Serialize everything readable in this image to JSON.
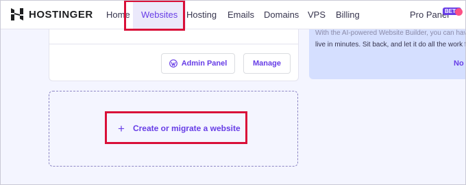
{
  "brand": {
    "name": "HOSTINGER"
  },
  "nav": {
    "items": [
      {
        "label": "Home"
      },
      {
        "label": "Websites"
      },
      {
        "label": "Hosting"
      },
      {
        "label": "Emails"
      },
      {
        "label": "Domains"
      },
      {
        "label": "VPS"
      },
      {
        "label": "Billing"
      },
      {
        "label": "Pro Panel"
      }
    ],
    "active": "Websites",
    "badge": "BETA"
  },
  "site_card": {
    "admin_panel_label": "Admin Panel",
    "manage_label": "Manage"
  },
  "promo": {
    "line1": "With the AI-powered Website Builder, you can have",
    "line2": "live in minutes. Sit back, and let it do all the work fo",
    "link": "No t"
  },
  "create": {
    "label": "Create or migrate a website",
    "icon": "plus-icon"
  },
  "colors": {
    "accent": "#673de6",
    "highlight": "#d90f38",
    "background": "#f4f5ff",
    "promo_bg": "#d5dfff"
  }
}
